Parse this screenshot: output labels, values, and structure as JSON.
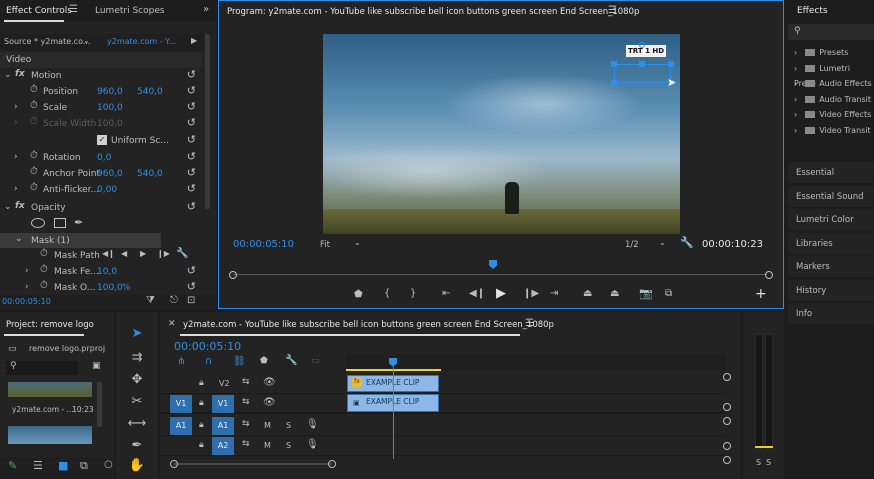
{
  "effect_controls": {
    "tab_label": "Effect Controls",
    "tab2_label": "Lumetri Scopes",
    "source_label": "Source * y2mate.co...",
    "source_seq": "y2mate.com - Y...",
    "section_video": "Video",
    "motion": "Motion",
    "position_label": "Position",
    "position_x": "960,0",
    "position_y": "540,0",
    "scale_label": "Scale",
    "scale_value": "100,0",
    "scale_width_label": "Scale Width",
    "scale_width_value": "100,0",
    "uniform_scale": "Uniform Sc...",
    "rotation_label": "Rotation",
    "rotation_value": "0,0",
    "anchor_label": "Anchor Point",
    "anchor_x": "960,0",
    "anchor_y": "540,0",
    "antiflicker_label": "Anti-flicker...",
    "antiflicker_value": "0,00",
    "opacity": "Opacity",
    "mask": "Mask (1)",
    "mask_path": "Mask Path",
    "mask_feather_label": "Mask Fe...",
    "mask_feather_value": "10,0",
    "mask_opacity_label": "Mask O...",
    "mask_opacity_value": "100,0",
    "mask_opacity_unit": "%",
    "timecode": "00:00:05:10"
  },
  "program": {
    "title": "Program: y2mate.com - YouTube like subscribe bell icon buttons green screen End Screen_1080p",
    "current_time": "00:00:05:10",
    "fit_label": "Fit",
    "resolution": "1/2",
    "duration": "00:00:10:23",
    "logo_text": "TRT 1 HD",
    "playhead_fraction": 0.487
  },
  "effects_panel": {
    "title": "Effects",
    "items": [
      "Presets",
      "Lumetri Prese",
      "Audio Effects",
      "Audio Transit",
      "Video Effects",
      "Video Transit"
    ],
    "side_items": [
      "Essential Graphics",
      "Essential Sound",
      "Lumetri Color",
      "Libraries",
      "Markers",
      "History",
      "Info"
    ]
  },
  "project": {
    "title": "Project: remove logo",
    "file_name": "remove logo.prproj",
    "clip_name": "y2mate.com - ...",
    "clip_duration": "10:23"
  },
  "timeline": {
    "title": "y2mate.com - YouTube like subscribe bell icon buttons green screen End Screen_1080p",
    "timecode": "00:00:05:10",
    "tracks": [
      "V2",
      "V1",
      "A1",
      "A2"
    ],
    "source_v1": "V1",
    "source_a1": "A1",
    "clip_v2": "EXAMPLE CLIP",
    "clip_v1": "EXAMPLE CLIP",
    "track_m": "M",
    "track_s": "S",
    "fx_badge": "fx"
  },
  "audio_meter": {
    "solo_left": "S",
    "solo_right": "S"
  },
  "colors": {
    "accent": "#2f8fe8",
    "clip": "#8db8e6",
    "panel_bg": "#232323"
  }
}
